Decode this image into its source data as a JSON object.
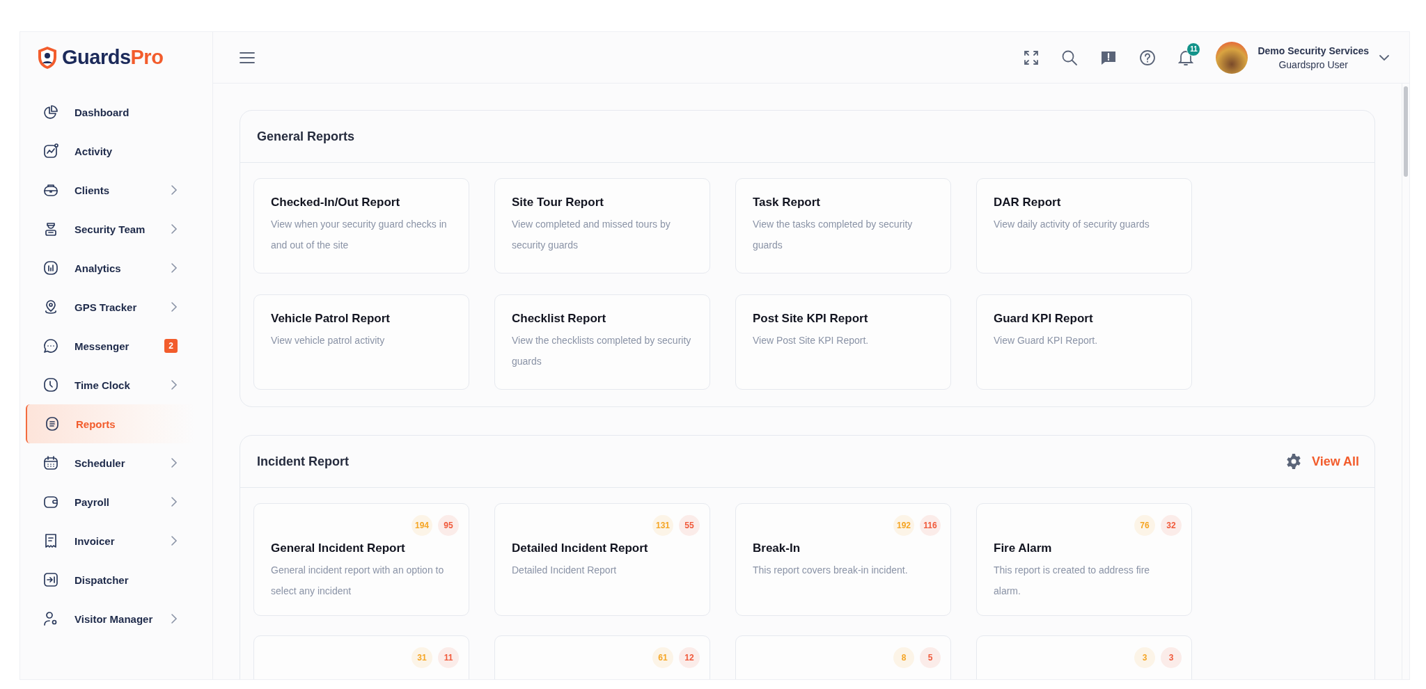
{
  "brand": {
    "name_part_1": "Guards",
    "name_part_2": "Pro"
  },
  "sidebar": {
    "items": [
      {
        "label": "Dashboard",
        "selected": false,
        "expandable": false
      },
      {
        "label": "Activity",
        "selected": false,
        "expandable": false
      },
      {
        "label": "Clients",
        "selected": false,
        "expandable": true
      },
      {
        "label": "Security Team",
        "selected": false,
        "expandable": true
      },
      {
        "label": "Analytics",
        "selected": false,
        "expandable": true
      },
      {
        "label": "GPS Tracker",
        "selected": false,
        "expandable": true
      },
      {
        "label": "Messenger",
        "selected": false,
        "expandable": false,
        "badge": "2"
      },
      {
        "label": "Time Clock",
        "selected": false,
        "expandable": true
      },
      {
        "label": "Reports",
        "selected": true,
        "expandable": false
      },
      {
        "label": "Scheduler",
        "selected": false,
        "expandable": true
      },
      {
        "label": "Payroll",
        "selected": false,
        "expandable": true
      },
      {
        "label": "Invoicer",
        "selected": false,
        "expandable": true
      },
      {
        "label": "Dispatcher",
        "selected": false,
        "expandable": false
      },
      {
        "label": "Visitor Manager",
        "selected": false,
        "expandable": true
      }
    ]
  },
  "header": {
    "notification_count": "11",
    "user": {
      "company": "Demo Security Services",
      "role": "Guardspro User"
    }
  },
  "general_reports": {
    "title": "General Reports",
    "cards": [
      {
        "title": "Checked-In/Out Report",
        "description": "View when your security guard checks in and out of the site"
      },
      {
        "title": "Site Tour Report",
        "description": "View completed and missed tours by security guards"
      },
      {
        "title": "Task Report",
        "description": "View the tasks completed by security guards"
      },
      {
        "title": "DAR Report",
        "description": "View daily activity of security guards"
      },
      {
        "title": "Vehicle Patrol Report",
        "description": "View vehicle patrol activity"
      },
      {
        "title": "Checklist Report",
        "description": "View the checklists completed by security guards"
      },
      {
        "title": "Post Site KPI Report",
        "description": "View Post Site KPI Report."
      },
      {
        "title": "Guard KPI Report",
        "description": "View Guard KPI Report."
      }
    ]
  },
  "incident_report": {
    "title": "Incident Report",
    "link": "View All",
    "cards": [
      {
        "title": "General Incident Report",
        "description": "General incident report with an option to select any incident",
        "badges": [
          {
            "text": "194",
            "color": "#f5a524"
          },
          {
            "text": "95",
            "color": "#f0593a"
          }
        ]
      },
      {
        "title": "Detailed Incident Report",
        "description": "Detailed Incident Report",
        "badges": [
          {
            "text": "131",
            "color": "#f5a524"
          },
          {
            "text": "55",
            "color": "#f0593a"
          }
        ]
      },
      {
        "title": "Break-In",
        "description": "This report covers break-in incident.",
        "badges": [
          {
            "text": "192",
            "color": "#f5a524"
          },
          {
            "text": "116",
            "color": "#f0593a"
          }
        ]
      },
      {
        "title": "Fire Alarm",
        "description": "This report is created to address fire alarm.",
        "badges": [
          {
            "text": "76",
            "color": "#f5a524"
          },
          {
            "text": "32",
            "color": "#f0593a"
          }
        ]
      },
      {
        "badges": [
          {
            "text": "31",
            "color": "#f5a524"
          },
          {
            "text": "11",
            "color": "#f0593a"
          }
        ]
      },
      {
        "badges": [
          {
            "text": "61",
            "color": "#f5a524"
          },
          {
            "text": "12",
            "color": "#f0593a"
          }
        ]
      },
      {
        "badges": [
          {
            "text": "8",
            "color": "#f5a524"
          },
          {
            "text": "5",
            "color": "#f0593a"
          }
        ]
      },
      {
        "badges": [
          {
            "text": "3",
            "color": "#f5a524"
          },
          {
            "text": "3",
            "color": "#f0593a"
          }
        ]
      }
    ]
  }
}
